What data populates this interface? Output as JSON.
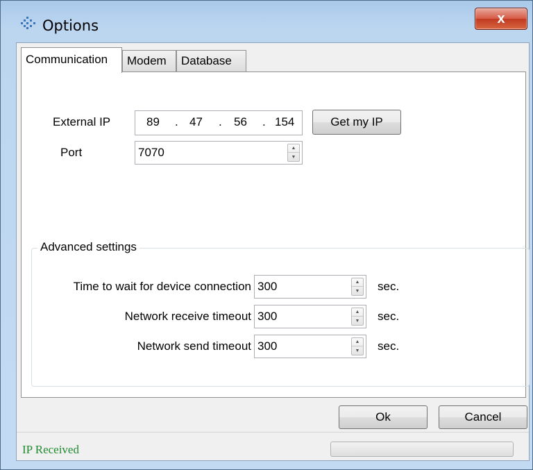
{
  "window": {
    "title": "Options",
    "close_label": "x"
  },
  "tabs": [
    {
      "label": "Communication",
      "active": true
    },
    {
      "label": "Modem",
      "active": false
    },
    {
      "label": "Database",
      "active": false
    }
  ],
  "communication": {
    "external_ip_label": "External IP",
    "ip": [
      "89",
      "47",
      "56",
      "154"
    ],
    "ip_separator": ".",
    "get_ip_button": "Get my IP",
    "port_label": "Port",
    "port_value": "7070"
  },
  "advanced": {
    "title": "Advanced settings",
    "rows": [
      {
        "label": "Time to wait for device connection",
        "value": "300",
        "unit": "sec."
      },
      {
        "label": "Network receive timeout",
        "value": "300",
        "unit": "sec."
      },
      {
        "label": "Network send timeout",
        "value": "300",
        "unit": "sec."
      }
    ]
  },
  "footer": {
    "ok_label": "Ok",
    "cancel_label": "Cancel",
    "status_text": "IP Received",
    "status_color": "#1e8a2e",
    "progress": 0
  },
  "colors": {
    "titlebar": "#bcd6f0",
    "close_button": "#c13a22"
  }
}
